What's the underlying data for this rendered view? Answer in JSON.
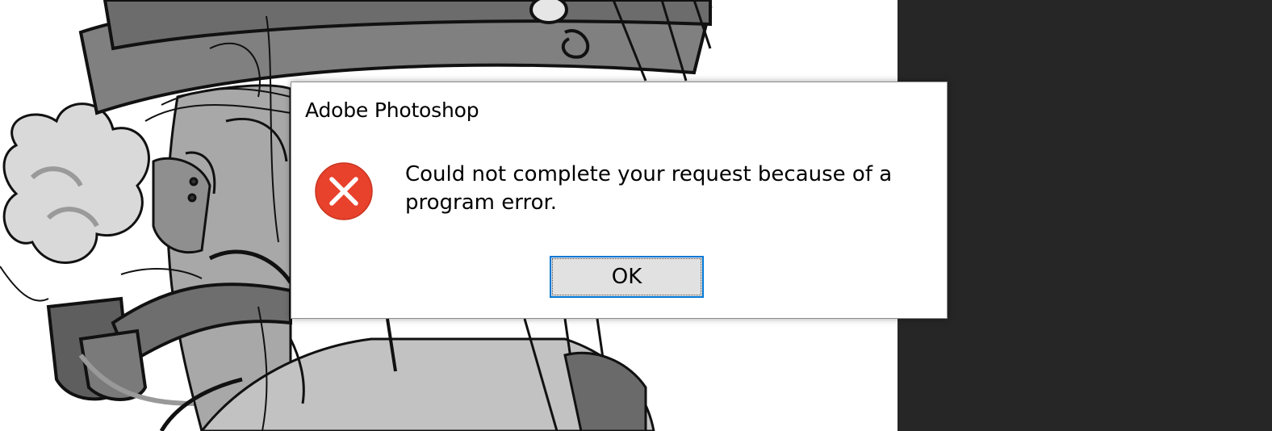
{
  "dialog": {
    "title": "Adobe Photoshop",
    "message": "Could not complete your request because of a program error.",
    "ok_label": "OK",
    "icon": "error-x-icon"
  },
  "colors": {
    "error_red": "#e8412c",
    "focus_blue": "#0078d7",
    "button_gray": "#e1e1e1",
    "workspace_dark": "#262626"
  }
}
